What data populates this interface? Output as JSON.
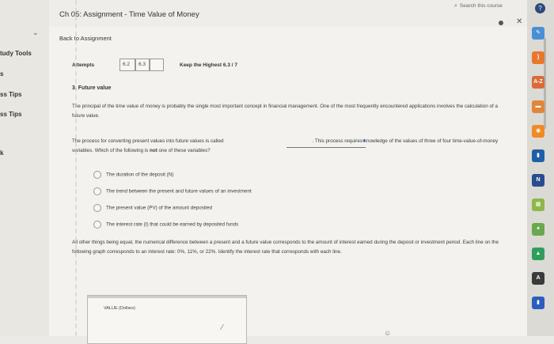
{
  "left_panel": {
    "items": [
      {
        "label": "tudy Tools"
      },
      {
        "label": "s"
      },
      {
        "label": "ss Tips"
      },
      {
        "label": "ss Tips"
      },
      {
        "label": "k"
      }
    ]
  },
  "header": {
    "title": "Ch 05: Assignment - Time Value of Money",
    "search_placeholder": "Search this course"
  },
  "back_link": "Back to Assignment",
  "attempts": {
    "label": "Attempts",
    "values": [
      "6.2",
      "6.3"
    ],
    "keep_highest": "Keep the Highest 6.3 / 7"
  },
  "question": {
    "title": "3. Future value",
    "intro": "The principal of the time value of money is probably the single most important concept in financial management. One of the most frequently encountered applications involves the calculation of a future value.",
    "process_before": "The process for converting present values into future values is called",
    "process_after": ". This process requires knowledge of the values of three of four time-value-of-money variables. Which of the following is ",
    "process_not": "not",
    "process_end": " one of these variables?",
    "options": [
      "The duration of the deposit (N)",
      "The trend between the present and future values of an investment",
      "The present value (PV) of the amount deposited",
      "The interest rate (I) that could be earned by deposited funds"
    ],
    "other_para": "All other things being equal, the numerical difference between a present and a future value corresponds to the amount of interest earned during the deposit or investment period. Each line on the following graph corresponds to an interest rate: 0%, 11%, or 22%. Identify the interest rate that corresponds with each line.",
    "graph_label": "VALUE (Dollars)"
  },
  "dock": {
    "icons": [
      {
        "name": "pen",
        "color": "#4a8fd6",
        "glyph": "✎"
      },
      {
        "name": "rss",
        "color": "#e8772e",
        "glyph": ")"
      },
      {
        "name": "az",
        "color": "#d96b3a",
        "glyph": "A-Z"
      },
      {
        "name": "ext-orange",
        "color": "#e0863a",
        "glyph": "▬"
      },
      {
        "name": "circle",
        "color": "#f08a24",
        "glyph": "◉"
      },
      {
        "name": "bookmark",
        "color": "#1d5fa8",
        "glyph": "▮"
      },
      {
        "name": "notes",
        "color": "#2a4c8f",
        "glyph": "N"
      },
      {
        "name": "green",
        "color": "#8cb84a",
        "glyph": "▦"
      },
      {
        "name": "puzzle",
        "color": "#6aa84f",
        "glyph": "✦"
      },
      {
        "name": "drive",
        "color": "#2f9e5a",
        "glyph": "▲"
      },
      {
        "name": "ext-a",
        "color": "#3a3a3a",
        "glyph": "A"
      },
      {
        "name": "calendar",
        "color": "#2a5dbf",
        "glyph": "▮"
      }
    ]
  }
}
